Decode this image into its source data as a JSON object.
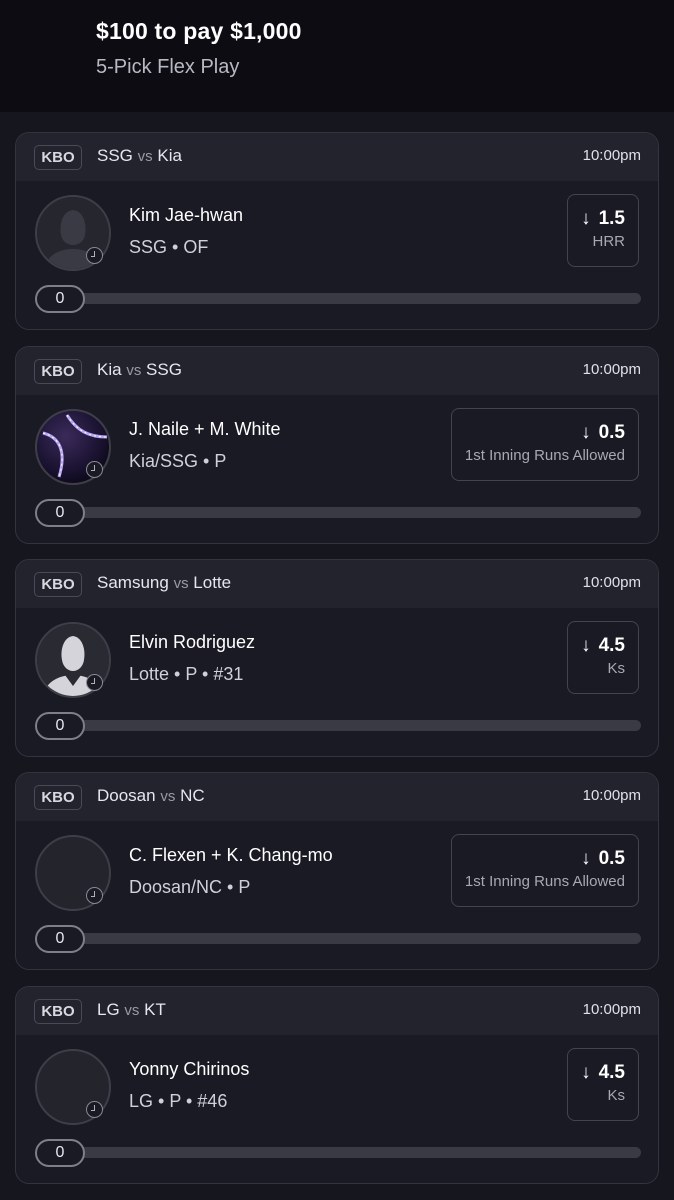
{
  "header": {
    "title": "$100 to pay $1,000",
    "subtitle": "5-Pick Flex Play"
  },
  "picks": [
    {
      "league": "KBO",
      "team1": "SSG",
      "vs": "vs",
      "team2": "Kia",
      "time": "10:00pm",
      "player_name": "Kim Jae-hwan",
      "player_meta": "SSG • OF",
      "direction_icon": "arrow-down-icon",
      "line": "1.5",
      "stat": "HRR",
      "progress_value": "0",
      "progress_fraction": 0,
      "avatar": "player-silhouette"
    },
    {
      "league": "KBO",
      "team1": "Kia",
      "vs": "vs",
      "team2": "SSG",
      "time": "10:00pm",
      "player_name": "J. Naile + M. White",
      "player_meta": "Kia/SSG • P",
      "direction_icon": "arrow-down-icon",
      "line": "0.5",
      "stat": "1st Inning Runs Allowed",
      "progress_value": "0",
      "progress_fraction": 0,
      "avatar": "baseball"
    },
    {
      "league": "KBO",
      "team1": "Samsung",
      "vs": "vs",
      "team2": "Lotte",
      "time": "10:00pm",
      "player_name": "Elvin Rodriguez",
      "player_meta": "Lotte • P • #31",
      "direction_icon": "arrow-down-icon",
      "line": "4.5",
      "stat": "Ks",
      "progress_value": "0",
      "progress_fraction": 0,
      "avatar": "player-silhouette-light"
    },
    {
      "league": "KBO",
      "team1": "Doosan",
      "vs": "vs",
      "team2": "NC",
      "time": "10:00pm",
      "player_name": "C. Flexen + K. Chang-mo",
      "player_meta": "Doosan/NC • P",
      "direction_icon": "arrow-down-icon",
      "line": "0.5",
      "stat": "1st Inning Runs Allowed",
      "progress_value": "0",
      "progress_fraction": 0,
      "avatar": "empty"
    },
    {
      "league": "KBO",
      "team1": "LG",
      "vs": "vs",
      "team2": "KT",
      "time": "10:00pm",
      "player_name": "Yonny Chirinos",
      "player_meta": "LG • P • #46",
      "direction_icon": "arrow-down-icon",
      "line": "4.5",
      "stat": "Ks",
      "progress_value": "0",
      "progress_fraction": 0,
      "avatar": "empty"
    }
  ]
}
